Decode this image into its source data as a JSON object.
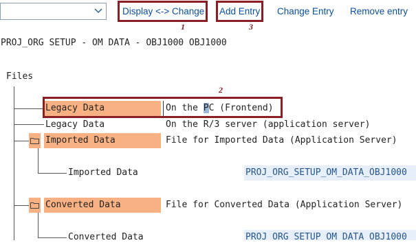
{
  "toolbar": {
    "dropdown_value": "",
    "buttons": [
      {
        "label": "Display <-> Change"
      },
      {
        "label": "Add Entry"
      },
      {
        "label": "Change Entry"
      },
      {
        "label": "Remove entry"
      }
    ]
  },
  "annotations": {
    "badge1": "1",
    "badge2": "2",
    "badge3": "3",
    "highlight_color": "#8b1d24"
  },
  "header": {
    "title": "PROJ_ORG SETUP - OM DATA - OBJ1000 OBJ1000"
  },
  "tree": {
    "root_label": "Files",
    "nodes": [
      {
        "label": "Legacy Data",
        "description_pre": "On the ",
        "description_sel": "P",
        "description_post": "C (Frontend)"
      },
      {
        "label": "Legacy Data",
        "description": "On the R/3 server (application server)"
      },
      {
        "label": "Imported Data",
        "description": "File for Imported Data (Application Server)",
        "icon": "folder-icon"
      },
      {
        "label": "Imported Data",
        "value": "PROJ_ORG_SETUP_OM_DATA_OBJ1000"
      },
      {
        "label": "Converted Data",
        "description": "File for Converted Data (Application Server)",
        "icon": "folder-icon"
      },
      {
        "label": "Converted Data",
        "value": "PROJ_ORG_SETUP_OM_DATA_OBJ1000"
      }
    ]
  },
  "colors": {
    "node_bg": "#f7b183",
    "value_bg": "#e6effa",
    "link": "#0a4f9e"
  }
}
